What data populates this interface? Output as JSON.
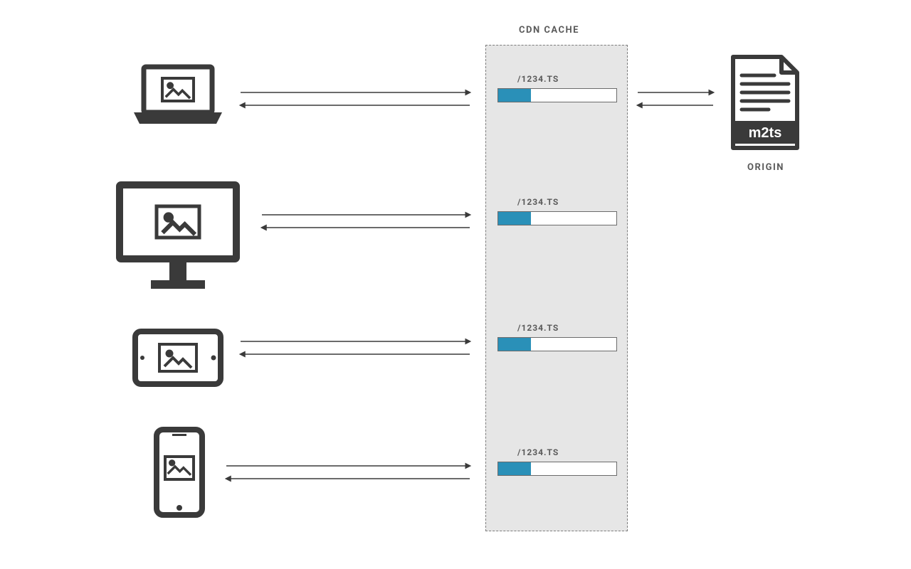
{
  "cdn": {
    "title": "CDN CACHE",
    "slots": [
      {
        "label": "/1234.TS",
        "fill_fraction": 0.28
      },
      {
        "label": "/1234.TS",
        "fill_fraction": 0.28
      },
      {
        "label": "/1234.TS",
        "fill_fraction": 0.28
      },
      {
        "label": "/1234.TS",
        "fill_fraction": 0.28
      }
    ]
  },
  "origin": {
    "label": "ORIGIN",
    "file_ext": "m2ts"
  },
  "devices": [
    {
      "name": "laptop"
    },
    {
      "name": "desktop-monitor"
    },
    {
      "name": "tablet"
    },
    {
      "name": "phone"
    }
  ],
  "colors": {
    "stroke": "#3a3a3a",
    "accent": "#2a90b8",
    "muted": "#7d7d7d",
    "cache_bg": "#e6e6e6"
  }
}
